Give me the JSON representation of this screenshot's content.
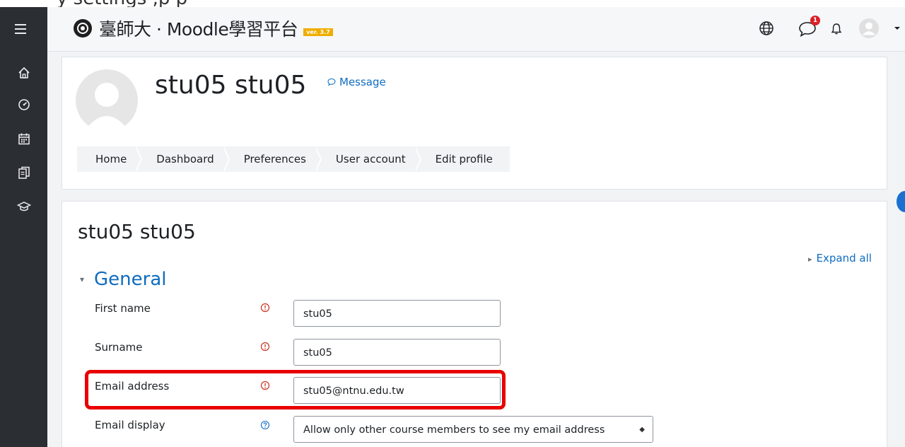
{
  "top_strip_text": "y         settings        ,p                            p",
  "brand": {
    "title": "臺師大 · Moodle學習平台",
    "version_badge": "ver. 3.7"
  },
  "navbar": {
    "message_count": "1"
  },
  "profile": {
    "name": "stu05 stu05",
    "message_link": "Message"
  },
  "breadcrumb": [
    "Home",
    "Dashboard",
    "Preferences",
    "User account",
    "Edit profile"
  ],
  "page_heading": "stu05 stu05",
  "expand_all": "Expand all",
  "section": {
    "title": "General"
  },
  "fields": {
    "first_name": {
      "label": "First name",
      "value": "stu05"
    },
    "surname": {
      "label": "Surname",
      "value": "stu05"
    },
    "email": {
      "label": "Email address",
      "value": "stu05@ntnu.edu.tw"
    },
    "email_display": {
      "label": "Email display",
      "value": "Allow only other course members to see my email address"
    }
  },
  "colors": {
    "accent": "#0f6cbf",
    "required": "#ca3120",
    "highlight": "#e80000",
    "sidebar": "#2b2f33"
  },
  "icons": {
    "menu": "hamburger-icon",
    "home": "home-icon",
    "dashboard": "dashboard-icon",
    "calendar": "calendar-icon",
    "files": "files-icon",
    "courses": "graduation-cap-icon",
    "language": "globe-icon",
    "messages": "message-bubble-icon",
    "notifications": "bell-icon",
    "user": "user-avatar-icon"
  }
}
